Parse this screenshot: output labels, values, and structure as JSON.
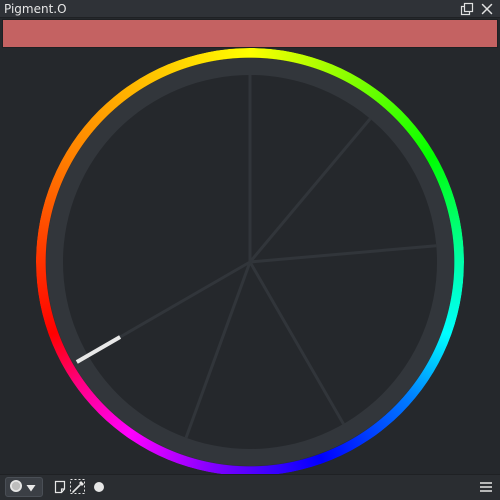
{
  "window": {
    "title": "Pigment.O",
    "float_icon": "float-dock-icon",
    "close_icon": "close-icon"
  },
  "color": {
    "current_hex": "#c46262",
    "hue_degrees": 0
  },
  "wheel": {
    "type": "hue-ring-with-harmony-spokes",
    "spoke_angles_deg": [
      0,
      40,
      85,
      150,
      200,
      240
    ],
    "selected_angle_deg": 240
  },
  "bottom_bar": {
    "mode_icon": "circle-mode-icon",
    "dropdown_icon": "triangle-down-icon",
    "note_icon": "note-icon",
    "picker_icon": "eyedropper-icon",
    "dot_icon": "dot-icon",
    "menu_icon": "hamburger-menu-icon"
  }
}
